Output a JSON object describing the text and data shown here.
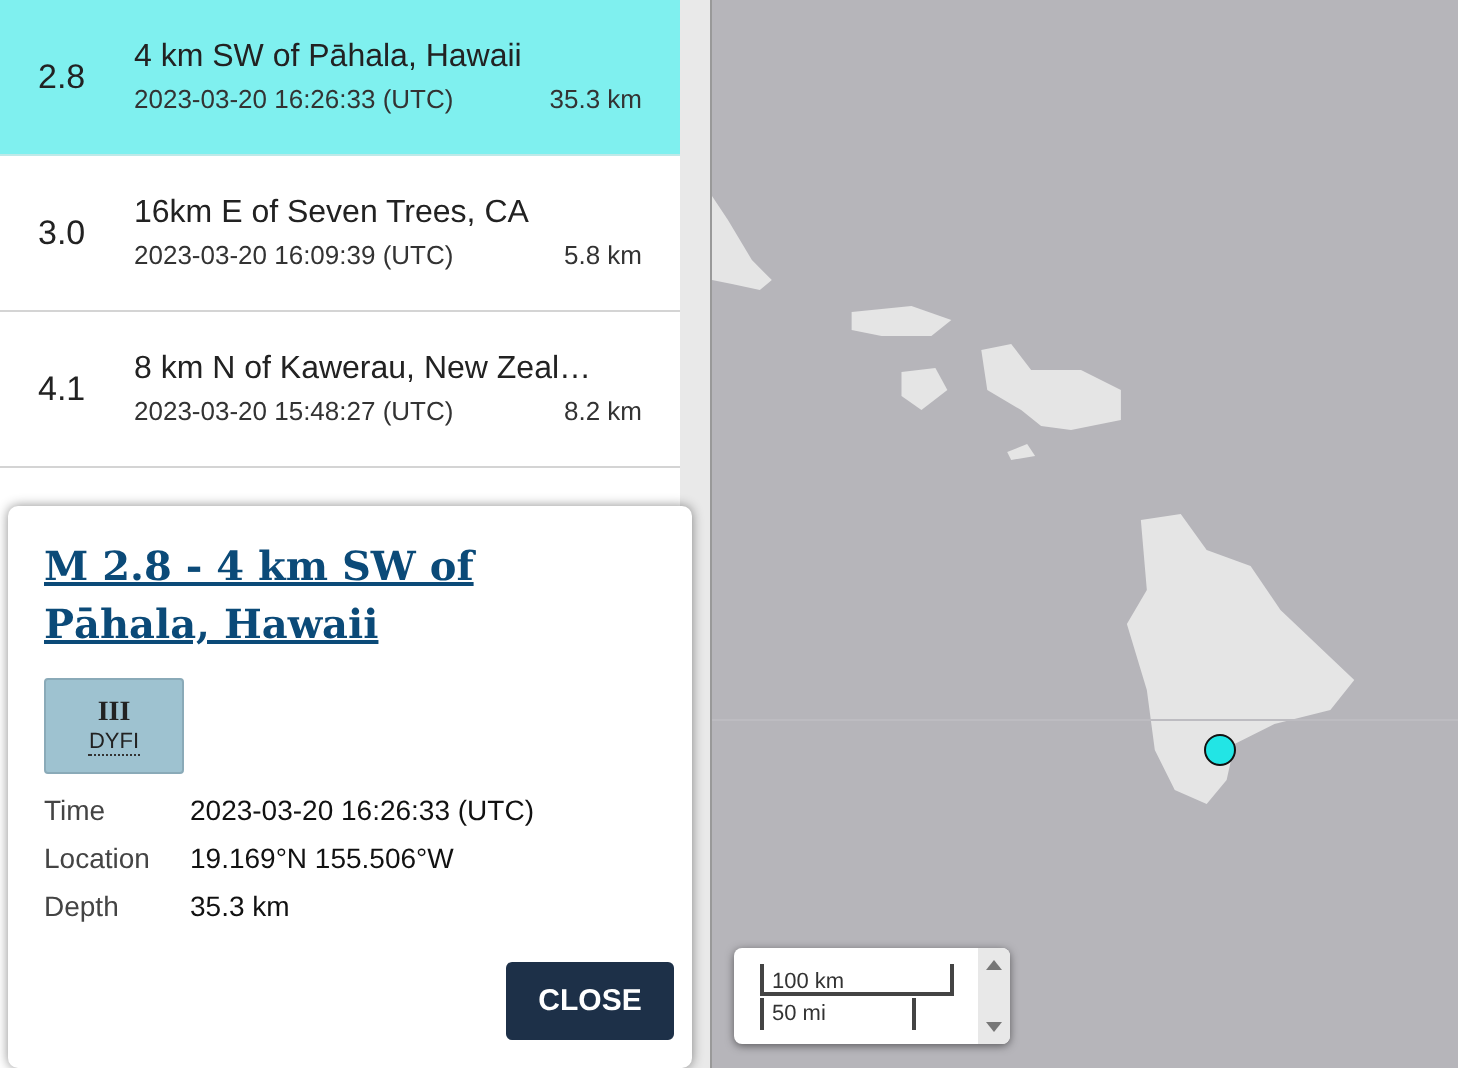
{
  "events": [
    {
      "magnitude": "2.8",
      "place": "4 km SW of Pāhala, Hawaii",
      "time": "2023-03-20 16:26:33 (UTC)",
      "depth": "35.3 km",
      "selected": true
    },
    {
      "magnitude": "3.0",
      "place": "16km E of Seven Trees, CA",
      "time": "2023-03-20 16:09:39 (UTC)",
      "depth": "5.8 km",
      "selected": false
    },
    {
      "magnitude": "4.1",
      "place": "8 km N of Kawerau, New Zeal…",
      "time": "2023-03-20 15:48:27 (UTC)",
      "depth": "8.2 km",
      "selected": false
    }
  ],
  "popup": {
    "title": "M 2.8 - 4 km SW of Pāhala, Hawaii",
    "dyfi": {
      "intensity": "III",
      "label": "DYFI"
    },
    "details": [
      {
        "label": "Time",
        "value": "2023-03-20 16:26:33 (UTC)"
      },
      {
        "label": "Location",
        "value": "19.169°N 155.506°W"
      },
      {
        "label": "Depth",
        "value": "35.3 km"
      }
    ],
    "close": "CLOSE"
  },
  "map": {
    "scale": {
      "metric": "100 km",
      "imperial": "50 mi"
    }
  }
}
